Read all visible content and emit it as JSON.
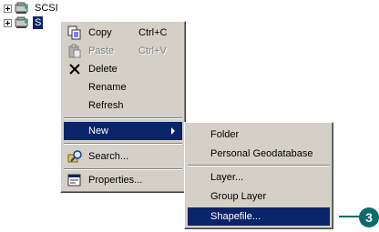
{
  "tree": [
    {
      "label": "SCSI",
      "icon": "server-icon",
      "selected": false
    },
    {
      "label": "S",
      "icon": "server-icon",
      "selected": true
    }
  ],
  "context_menu": {
    "items": [
      {
        "label": "Copy",
        "shortcut": "Ctrl+C",
        "icon": "copy-icon",
        "disabled": false
      },
      {
        "label": "Paste",
        "shortcut": "Ctrl+V",
        "icon": "paste-icon",
        "disabled": true
      },
      {
        "label": "Delete",
        "icon": "delete-icon",
        "disabled": false
      },
      {
        "label": "Rename",
        "disabled": false
      },
      {
        "label": "Refresh",
        "disabled": false
      },
      {
        "label": "New",
        "has_submenu": true,
        "highlighted": true
      },
      {
        "label": "Search...",
        "icon": "search-icon",
        "disabled": false
      },
      {
        "label": "Properties...",
        "icon": "properties-icon",
        "disabled": false
      }
    ]
  },
  "submenu": {
    "items": [
      {
        "label": "Folder"
      },
      {
        "label": "Personal Geodatabase"
      },
      {
        "label": "Layer..."
      },
      {
        "label": "Group Layer"
      },
      {
        "label": "Shapefile...",
        "highlighted": true
      }
    ]
  },
  "callout": {
    "number": "3"
  },
  "colors": {
    "highlight": "#0a246a",
    "menu_bg": "#d4d0c8",
    "callout": "#0a6b6b"
  }
}
